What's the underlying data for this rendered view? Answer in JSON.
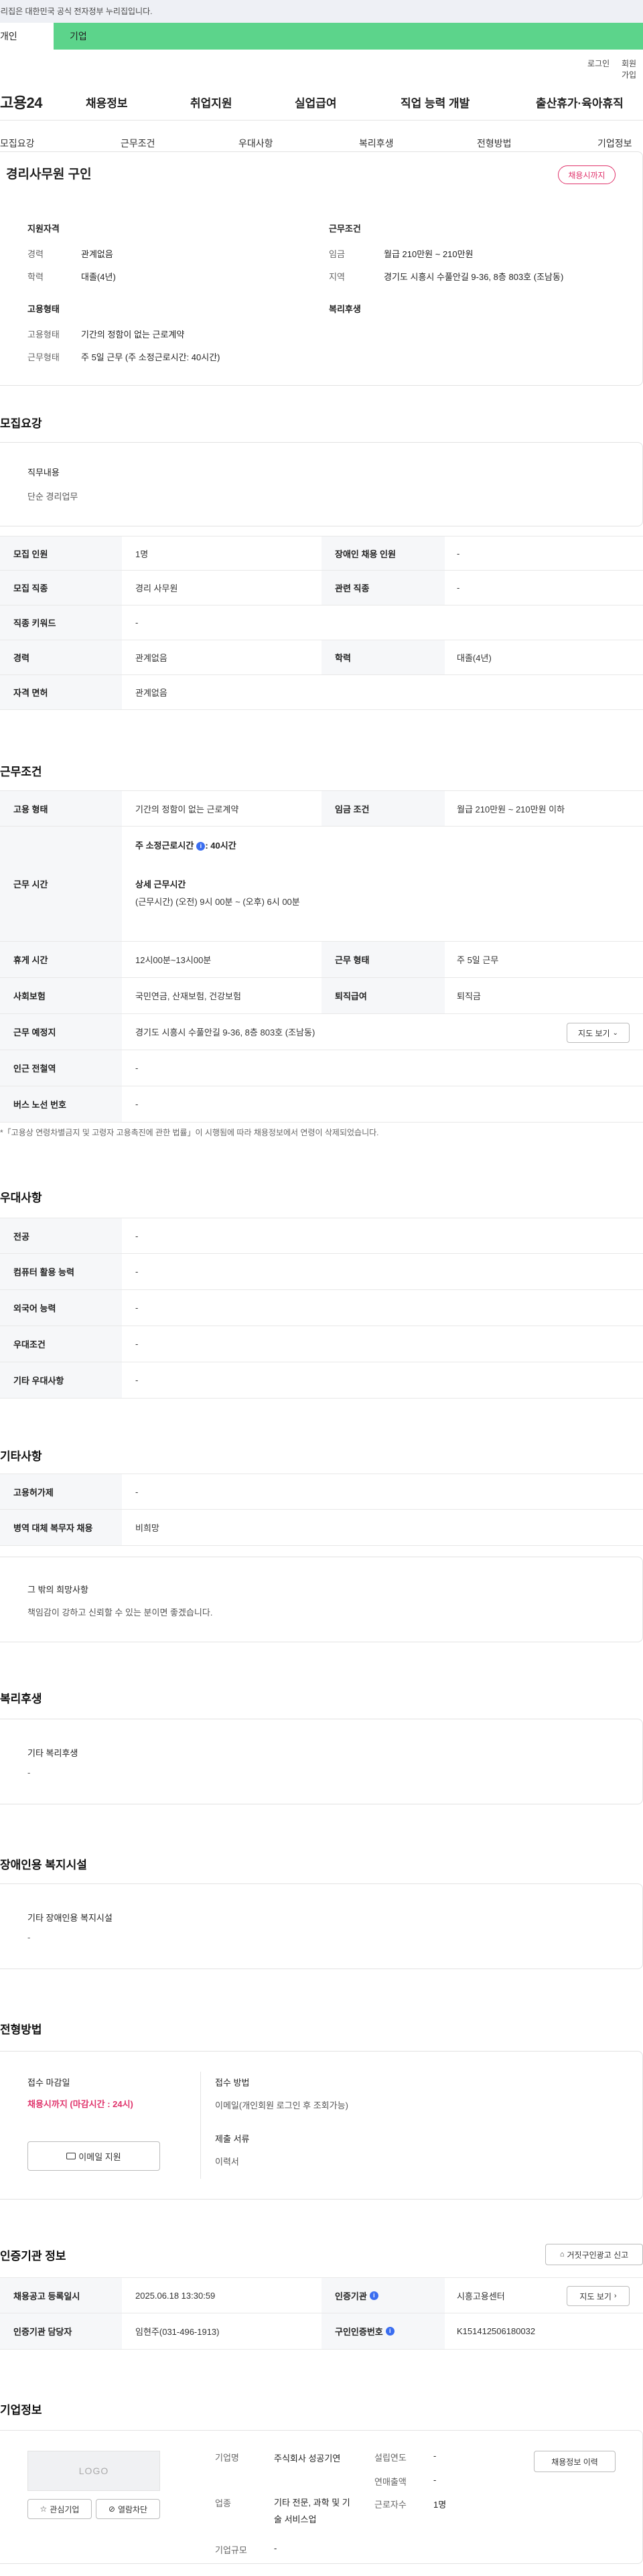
{
  "gov_notice": "누리집은 대한민국 공식 전자정부 누리집입니다.",
  "tabs": {
    "personal": "개인",
    "company": "기업"
  },
  "util": {
    "login": "로그인",
    "signup": "회원가입"
  },
  "header": {
    "logo": "고용24",
    "menu": [
      "채용정보",
      "취업지원",
      "실업급여",
      "직업 능력 개발",
      "출산휴가·육아휴직"
    ]
  },
  "subnav": [
    "모집요강",
    "근무조건",
    "우대사항",
    "복리후생",
    "전형방법",
    "기업정보"
  ],
  "summary": {
    "title": "경리사무원 구인",
    "badge": "채용시까지",
    "qual_title": "지원자격",
    "career_label": "경력",
    "career_value": "관계없음",
    "edu_label": "학력",
    "edu_value": "대졸(4년)",
    "work_title": "근무조건",
    "wage_label": "임금",
    "wage_value": "월급 210만원 ~ 210만원",
    "region_label": "지역",
    "region_value": "경기도 시흥시 수풀안길 9-36, 8층 803호 (조남동)",
    "emp_title": "고용형태",
    "emp_type_label": "고용형태",
    "emp_type_value": "기간의 정함이 없는 근로계약",
    "emp_form_label": "근무형태",
    "emp_form_value": "주 5일 근무 (주 소정근로시간: 40시간)",
    "welfare_title": "복리후생"
  },
  "recruit": {
    "title": "모집요강",
    "duty_label": "직무내용",
    "duty_value": "단순 경리업무",
    "rows": {
      "count_label": "모집 인원",
      "count_value": "1명",
      "disabled_label": "장애인 채용 인원",
      "disabled_value": "-",
      "job_label": "모집 직종",
      "job_value": "경리 사무원",
      "related_label": "관련 직종",
      "related_value": "-",
      "keyword_label": "직종 키워드",
      "keyword_value": "-",
      "career_label": "경력",
      "career_value": "관계없음",
      "edu_label": "학력",
      "edu_value": "대졸(4년)",
      "license_label": "자격 면허",
      "license_value": "관계없음"
    }
  },
  "conditions": {
    "title": "근무조건",
    "emp_type_label": "고용 형태",
    "emp_type_value": "기간의 정함이 없는 근로계약",
    "wage_label": "임금 조건",
    "wage_value": "월급 210만원 ~ 210만원 이하",
    "hours_label": "근무 시간",
    "hours_week": "주 소정근로시간",
    "hours_week_value": ": 40시간",
    "hours_detail_title": "상세 근무시간",
    "hours_detail_value": "(근무시간) (오전) 9시 00분 ~ (오후) 6시 00분",
    "break_label": "휴게 시간",
    "break_value": "12시00분~13시00분",
    "form_label": "근무 형태",
    "form_value": "주 5일 근무",
    "insurance_label": "사회보험",
    "insurance_value": "국민연금, 산재보험, 건강보험",
    "severance_label": "퇴직급여",
    "severance_value": "퇴직금",
    "place_label": "근무 예정지",
    "place_value": "경기도 시흥시 수풀안길 9-36, 8층 803호 (조남동)",
    "map_button": "지도 보기",
    "subway_label": "인근 전철역",
    "subway_value": "-",
    "bus_label": "버스 노선 번호",
    "bus_value": "-",
    "note": "*「고용상 연령차별금지 및 고령자 고용촉진에 관한 법률」이 시행됨에 따라 채용정보에서 연령이 삭제되었습니다."
  },
  "preference": {
    "title": "우대사항",
    "major_label": "전공",
    "major_value": "-",
    "computer_label": "컴퓨터 활용 능력",
    "computer_value": "-",
    "language_label": "외국어 능력",
    "language_value": "-",
    "condition_label": "우대조건",
    "condition_value": "-",
    "other_label": "기타 우대사항",
    "other_value": "-"
  },
  "etc": {
    "title": "기타사항",
    "permit_label": "고용허가제",
    "permit_value": "-",
    "military_label": "병역 대체 복무자 채용",
    "military_value": "비희망",
    "wish_title": "그 밖의 희망사항",
    "wish_value": "책임감이 강하고 신뢰할 수 있는 분이면 좋겠습니다."
  },
  "welfare": {
    "title": "복리후생",
    "other_label": "기타 복리후생",
    "other_value": "-"
  },
  "disabled_facility": {
    "title": "장애인용 복지시설",
    "other_label": "기타 장애인용 복지시설",
    "other_value": "-"
  },
  "selection": {
    "title": "전형방법",
    "deadline_label": "접수 마감일",
    "deadline_value": "채용시까지 (마감시간 : 24시)",
    "email_button": "이메일 지원",
    "method_label": "접수 방법",
    "method_value": "이메일(개인회원 로그인 후 조회가능)",
    "docs_label": "제출 서류",
    "docs_value": "이력서"
  },
  "cert": {
    "title": "인증기관 정보",
    "report_button": "거짓구인광고 신고",
    "reg_label": "채용공고 등록일시",
    "reg_value": "2025.06.18 13:30:59",
    "org_label": "인증기관",
    "org_value": "시흥고용센터",
    "map_button": "지도 보기",
    "staff_label": "인증기관 담당자",
    "staff_value": "임현주(031-496-1913)",
    "no_label": "구인인증번호",
    "no_value": "K151412506180032"
  },
  "company": {
    "title": "기업정보",
    "logo_text": "LOGO",
    "interest_button": "관심기업",
    "block_button": "열람차단",
    "name_label": "기업명",
    "name_value": "주식회사 성공기연",
    "industry_label": "업종",
    "industry_value": "기타 전문, 과학 및 기술 서비스업",
    "size_label": "기업규모",
    "size_value": "-",
    "founded_label": "설립연도",
    "founded_value": "-",
    "revenue_label": "연매출액",
    "revenue_value": "-",
    "workers_label": "근로자수",
    "workers_value": "1명",
    "history_button": "채용정보 이력"
  }
}
